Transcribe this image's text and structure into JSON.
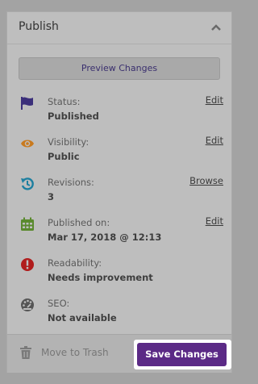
{
  "panel": {
    "title": "Publish",
    "preview_label": "Preview Changes"
  },
  "rows": [
    {
      "icon": "flag-icon",
      "label": "Status:",
      "value": "Published",
      "action": "Edit"
    },
    {
      "icon": "eye-icon",
      "label": "Visibility:",
      "value": "Public",
      "action": "Edit"
    },
    {
      "icon": "revisions-icon",
      "label": "Revisions:",
      "value": "3",
      "action": "Browse"
    },
    {
      "icon": "calendar-icon",
      "label": "Published on:",
      "value": "Mar 17, 2018 @ 12:13",
      "action": "Edit"
    },
    {
      "icon": "readability-icon",
      "label": "Readability:",
      "value": "Needs improvement",
      "action": ""
    },
    {
      "icon": "seo-icon",
      "label": "SEO:",
      "value": "Not available",
      "action": ""
    }
  ],
  "footer": {
    "trash_label": "Move to Trash",
    "save_label": "Save Changes"
  },
  "colors": {
    "accent": "#5b2a86",
    "flag": "#3b2f7a",
    "eye": "#c97a1e",
    "revisions": "#1d7fa0",
    "calendar": "#5a8a2e",
    "readability": "#b01c1c",
    "seo": "#555555"
  }
}
